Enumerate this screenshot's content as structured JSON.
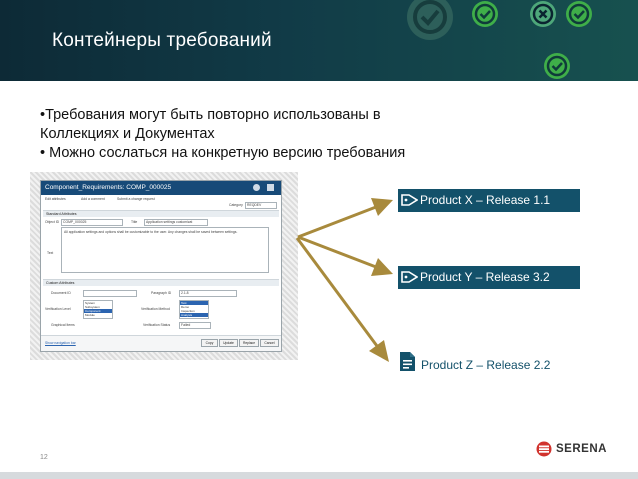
{
  "slide": {
    "title": "Контейнеры требований",
    "bullets": [
      "•Требования могут быть повторно использованы в",
      "Коллекциях и Документах",
      "• Можно сослаться на конкретную версию требования"
    ],
    "page_number": "12"
  },
  "header_icons": [
    "check-icon",
    "check-icon",
    "cross-icon",
    "check-icon",
    "check-icon"
  ],
  "screenshot": {
    "window_title": "Component_Requirements: COMP_000025",
    "tabs": [
      "Edit attributes",
      "Add a comment",
      "Submit a change request"
    ],
    "category_label": "Category",
    "category_value": "REQDEV",
    "standard_section": "Standard Attributes",
    "object_id_label": "Object ID",
    "object_id_value": "COMP_000025",
    "title_label": "Title",
    "title_value": "Application settings customizat",
    "description_value": "All application settings and options shall be customizable to the user. Any changes shall be saved between settings.",
    "text_label": "Text",
    "custom_section": "Custom Attributes",
    "document_id_label": "Document ID",
    "paragraph_id_label": "Paragraph ID",
    "paragraph_id_value": "2.1.8",
    "verification_level_label": "Verification Level",
    "verification_level_options": [
      "System",
      "Subsystem",
      "Component",
      "Module"
    ],
    "verification_method_label": "Verification Method",
    "verification_method_options": [
      "Test",
      "Demo",
      "Inspection",
      "Analysis"
    ],
    "graphical_items_label": "Graphical Items",
    "verification_status_label": "Verification Status",
    "verification_status_value": "Failed",
    "navigation_link": "Show navigation bar",
    "buttons": [
      "Copy",
      "Update",
      "Replace",
      "Cancel"
    ]
  },
  "products": [
    {
      "label": "Product X – Release 1.1",
      "icon": "tag-icon"
    },
    {
      "label": "Product Y – Release 3.2",
      "icon": "tag-icon"
    },
    {
      "label": "Product Z – Release 2.2",
      "icon": "document-icon"
    }
  ],
  "logo": {
    "text": "SERENA"
  },
  "colors": {
    "header_dark": "#0d2a36",
    "header_teal": "#17514f",
    "check_green": "#3fae49",
    "cross_dark": "#0a2430",
    "tag_blue": "#13516a",
    "arrow_gold": "#a88a3c",
    "logo_red": "#d1332e"
  }
}
